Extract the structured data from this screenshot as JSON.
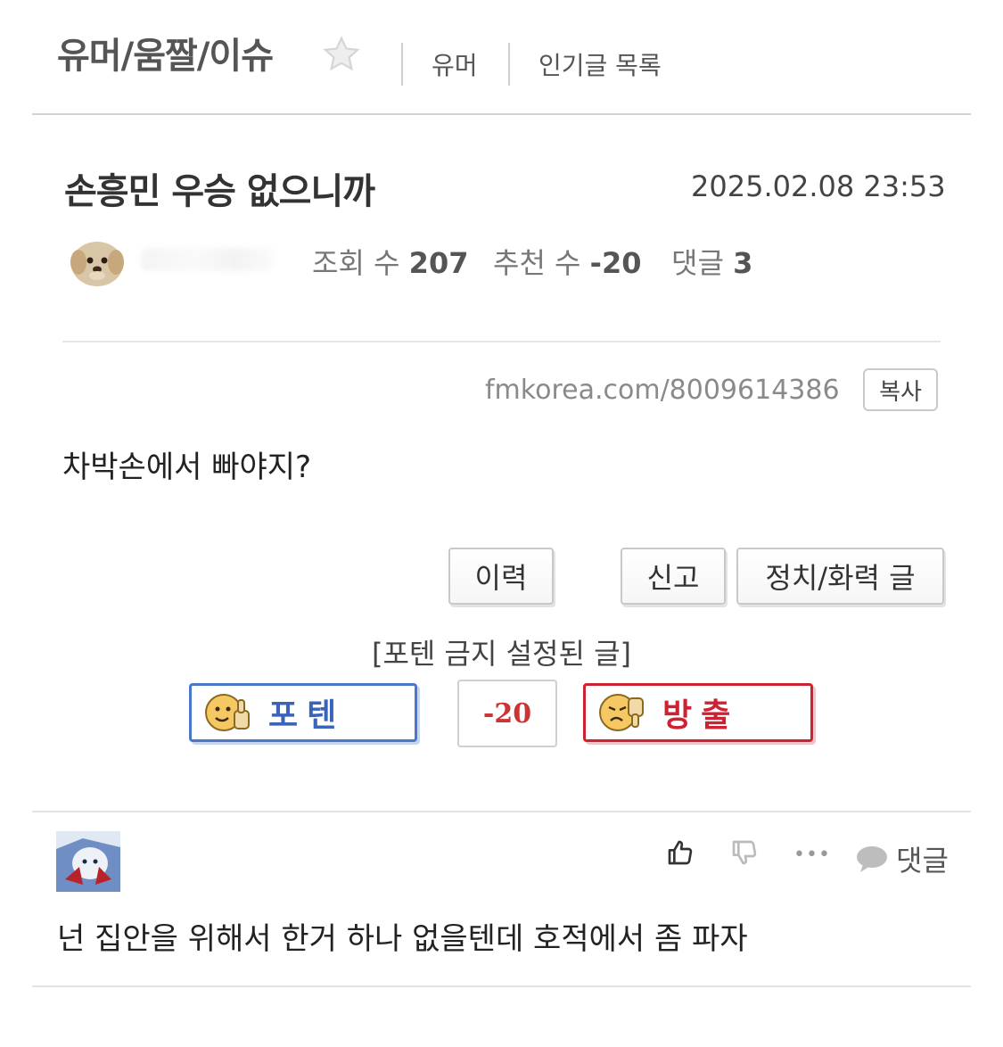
{
  "header": {
    "board_title": "유머/움짤/이슈",
    "links": [
      "유머",
      "인기글 목록"
    ]
  },
  "post": {
    "title": "손흥민 우승 없으니까",
    "date": "2025.02.08 23:53",
    "views_label": "조회 수",
    "views": "207",
    "recommends_label": "추천 수",
    "recommends": "-20",
    "comments_label": "댓글",
    "comments": "3",
    "url": "fmkorea.com/8009614386",
    "copy_label": "복사",
    "body": "차박손에서 빠야지?"
  },
  "actions": {
    "history": "이력",
    "report": "신고",
    "political": "정치/화력 글"
  },
  "vote": {
    "notice": "[포텐 금지 설정된 글]",
    "up_label": "포텐",
    "count": "-20",
    "down_label": "방출"
  },
  "comment": {
    "reply_label": "댓글",
    "more": "•••",
    "text": "넌 집안을 위해서 한거 하나 없을텐데 호적에서 좀 파자"
  },
  "colors": {
    "up_border": "#4a78c8",
    "down_border": "#cc2233",
    "count_text": "#cc3333"
  }
}
